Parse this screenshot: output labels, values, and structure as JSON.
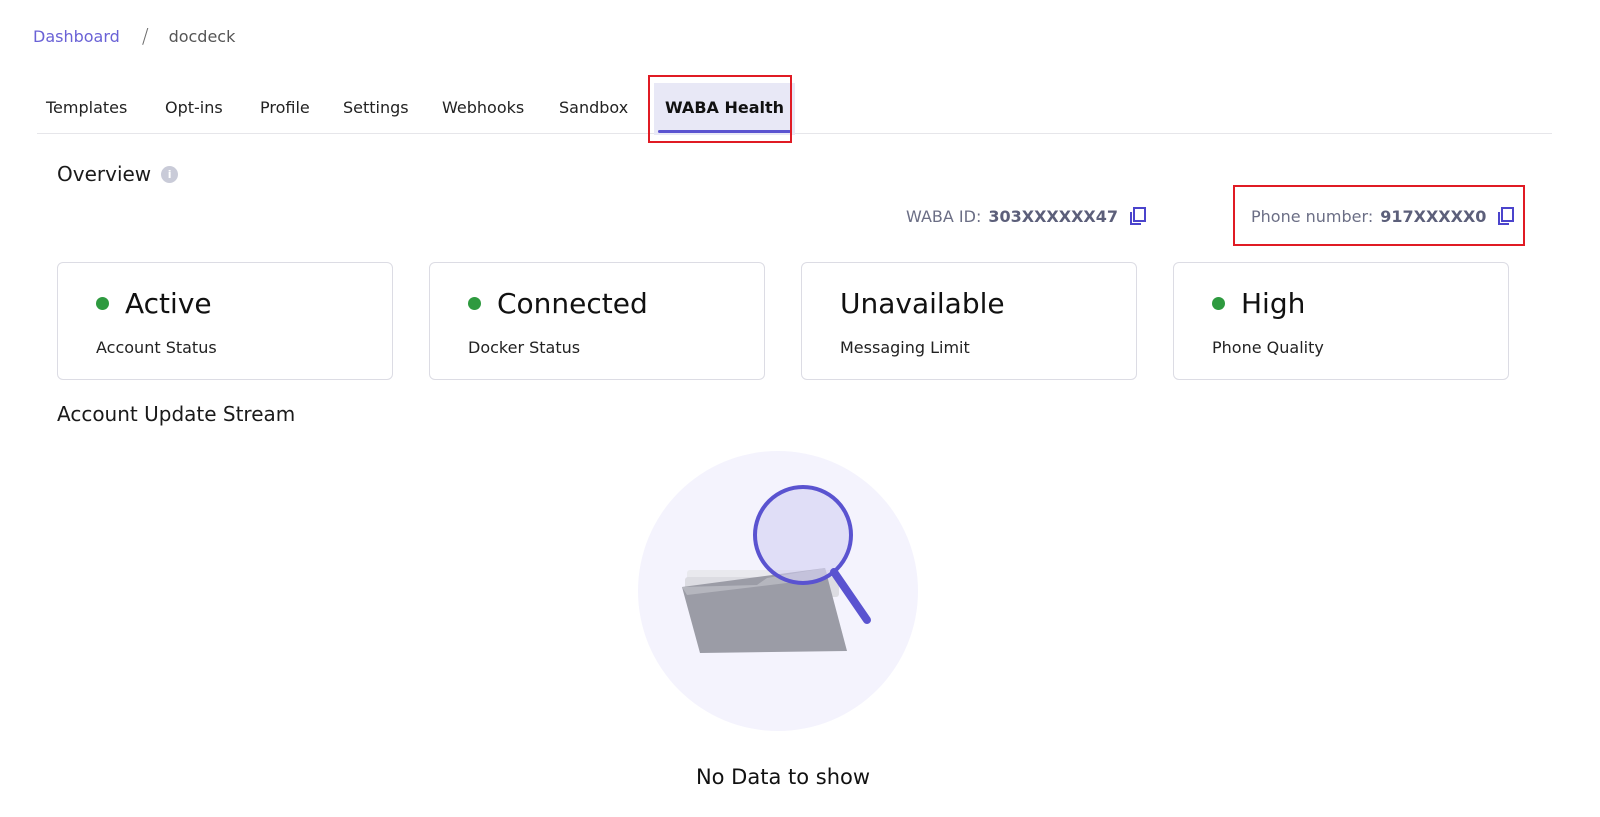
{
  "breadcrumb": {
    "root": "Dashboard",
    "separator": "/",
    "current": "docdeck"
  },
  "tabs": [
    {
      "label": "Templates"
    },
    {
      "label": "Opt-ins"
    },
    {
      "label": "Profile"
    },
    {
      "label": "Settings"
    },
    {
      "label": "Webhooks"
    },
    {
      "label": "Sandbox"
    },
    {
      "label": "WABA Health",
      "active": true
    }
  ],
  "overview": {
    "title": "Overview",
    "info_icon": "i",
    "waba_id_label": "WABA ID:",
    "waba_id_value": "303XXXXXX47",
    "phone_label": "Phone number:",
    "phone_value": "917XXXXX0"
  },
  "cards": [
    {
      "value": "Active",
      "label": "Account Status",
      "status_color": "#2e9a3f"
    },
    {
      "value": "Connected",
      "label": "Docker Status",
      "status_color": "#2e9a3f"
    },
    {
      "value": "Unavailable",
      "label": "Messaging Limit"
    },
    {
      "value": "High",
      "label": "Phone Quality",
      "status_color": "#2e9a3f"
    }
  ],
  "stream": {
    "title": "Account Update Stream",
    "empty_text": "No Data to show",
    "empty_icon": "empty-folder-search-illustration"
  },
  "colors": {
    "accent": "#5a53d0",
    "highlight": "#e01b24",
    "status_green": "#2e9a3f"
  }
}
